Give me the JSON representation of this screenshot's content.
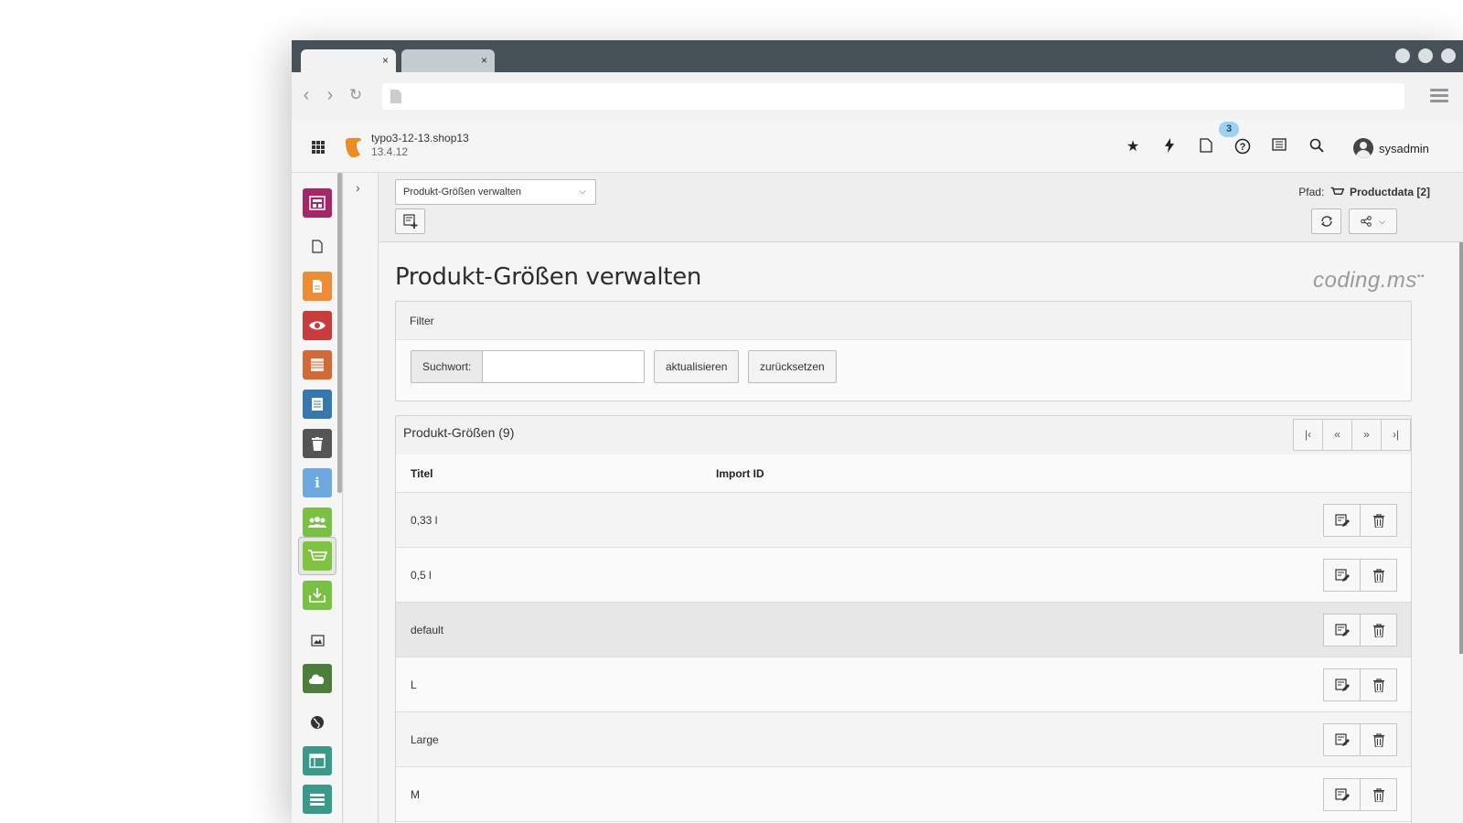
{
  "browser": {
    "tabs": [
      {
        "close": "×"
      },
      {
        "close": "×"
      }
    ]
  },
  "topbar": {
    "site_name": "typo3-12-13.shop13",
    "site_version": "13.4.12",
    "notification_count": "3",
    "username": "sysadmin"
  },
  "docheader": {
    "function_select": "Produkt-Größen verwalten",
    "path_label": "Pfad:",
    "path_value": "Productdata [2]"
  },
  "page": {
    "title": "Produkt-Größen verwalten",
    "brand": "coding.ms"
  },
  "filter": {
    "title": "Filter",
    "search_label": "Suchwort:",
    "search_value": "",
    "update_button": "aktualisieren",
    "reset_button": "zurücksetzen"
  },
  "list": {
    "title": "Produkt-Größen (9)",
    "columns": [
      "Titel",
      "Import ID"
    ],
    "rows": [
      {
        "title": "0,33 l",
        "import_id": ""
      },
      {
        "title": "0,5 l",
        "import_id": ""
      },
      {
        "title": "default",
        "import_id": ""
      },
      {
        "title": "L",
        "import_id": ""
      },
      {
        "title": "Large",
        "import_id": ""
      },
      {
        "title": "M",
        "import_id": ""
      }
    ]
  },
  "modules": [
    {
      "icon": "web-layout-icon",
      "color": "#a4276a"
    },
    {
      "icon": "page-icon",
      "color": ""
    },
    {
      "icon": "list-page-icon",
      "color": "#ee8c34"
    },
    {
      "icon": "preview-eye-icon",
      "color": "#c83c3c"
    },
    {
      "icon": "list-module-icon",
      "color": "#d36a34"
    },
    {
      "icon": "info-document-icon",
      "color": "#3777b0"
    },
    {
      "icon": "recycler-icon",
      "color": "#555555"
    },
    {
      "icon": "info-icon",
      "color": "#6ca9e0"
    },
    {
      "icon": "users-icon",
      "color": "#79c143"
    },
    {
      "icon": "shop-cart-icon",
      "color": "#7fc43d"
    },
    {
      "icon": "import-icon",
      "color": "#79c143"
    },
    {
      "icon": "image-icon",
      "color": ""
    },
    {
      "icon": "cloud-icon",
      "color": "#4c7d3a"
    },
    {
      "icon": "globe-icon",
      "color": ""
    },
    {
      "icon": "template-icon",
      "color": "#3a9a8a"
    },
    {
      "icon": "form-icon",
      "color": "#3a9a8a"
    }
  ]
}
